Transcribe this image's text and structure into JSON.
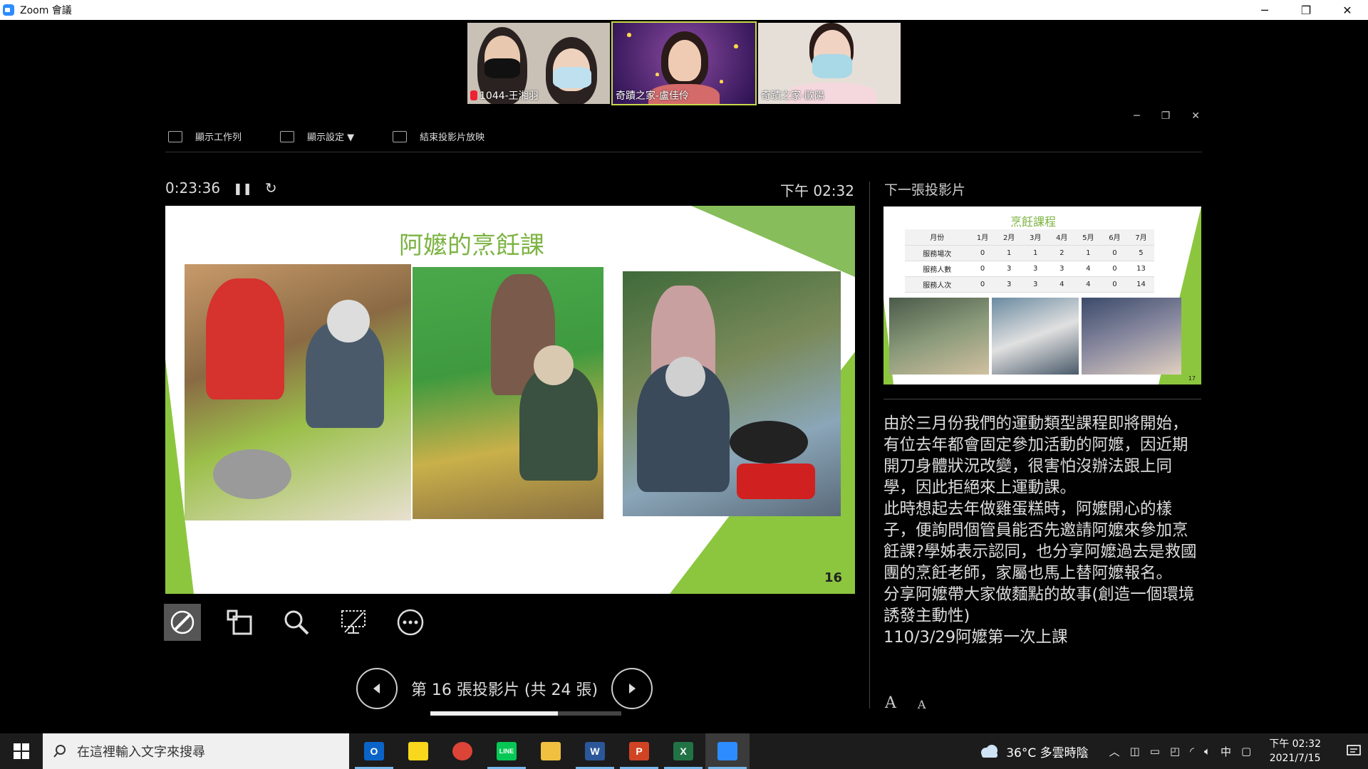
{
  "window": {
    "title": "Zoom 會議",
    "controls": [
      "─",
      "❐",
      "✕"
    ]
  },
  "video": {
    "tiles": [
      {
        "name": "1044-王湘羽",
        "muted": true,
        "bg": "#c9c1b6"
      },
      {
        "name": "奇蹟之家-盧佳伶",
        "muted": false,
        "bg": "#5a2a7a",
        "active": true
      },
      {
        "name": "奇蹟之家-歐陽",
        "muted": false,
        "bg": "#e6dfd8"
      }
    ]
  },
  "presenter": {
    "toolbar": {
      "show_taskbar": "顯示工作列",
      "display_settings": "顯示設定 ▼",
      "end_slideshow": "結束投影片放映"
    },
    "window_controls": [
      "─",
      "❐",
      "✕"
    ],
    "timer": "0:23:36",
    "clock": "下午 02:32",
    "next_label": "下一張投影片"
  },
  "slide": {
    "title": "阿嬤的烹飪課",
    "number": "16",
    "accent": "#8cc63f"
  },
  "next_slide": {
    "title": "烹飪課程",
    "number": "17",
    "table": {
      "headers": [
        "月份",
        "1月",
        "2月",
        "3月",
        "4月",
        "5月",
        "6月",
        "7月"
      ],
      "rows": [
        [
          "服務場次",
          "0",
          "1",
          "1",
          "2",
          "1",
          "0",
          "5"
        ],
        [
          "服務人數",
          "0",
          "3",
          "3",
          "3",
          "4",
          "0",
          "13"
        ],
        [
          "服務人次",
          "0",
          "3",
          "3",
          "4",
          "4",
          "0",
          "14"
        ]
      ]
    }
  },
  "notes": {
    "lines": [
      "由於三月份我們的運動類型課程即將開始，有位去年都會固定參加活動的阿嬤，因近期開刀身體狀況改變，很害怕沒辦法跟上同學，因此拒絕來上運動課。",
      "此時想起去年做雞蛋糕時，阿嬤開心的樣子，便詢問個管員能否先邀請阿嬤來參加烹飪課?學姊表示認同，也分享阿嬤過去是救國團的烹飪老師，家屬也馬上替阿嬤報名。",
      "分享阿嬤帶大家做麵點的故事(創造一個環境 誘發主動性)",
      "110/3/29阿嬤第一次上課"
    ],
    "font_increase": "A",
    "font_decrease": "A"
  },
  "navigation": {
    "label": "第 16 張投影片 (共 24 張)",
    "progress": 0.6667
  },
  "taskbar": {
    "search_placeholder": "在這裡輸入文字來搜尋",
    "apps": [
      {
        "name": "outlook",
        "letter": "O",
        "color": "#0a64c8",
        "running": true
      },
      {
        "name": "sticky-notes",
        "letter": "",
        "color": "#f9d71c",
        "running": false
      },
      {
        "name": "chrome",
        "letter": "",
        "color": "#db4437",
        "running": false
      },
      {
        "name": "line",
        "letter": "LINE",
        "color": "#06c755",
        "running": true
      },
      {
        "name": "file-explorer",
        "letter": "",
        "color": "#f0c040",
        "running": false
      },
      {
        "name": "word",
        "letter": "W",
        "color": "#2b579a",
        "running": true
      },
      {
        "name": "powerpoint",
        "letter": "P",
        "color": "#d04423",
        "running": true
      },
      {
        "name": "excel",
        "letter": "X",
        "color": "#217346",
        "running": true
      },
      {
        "name": "zoom",
        "letter": "",
        "color": "#2d8cff",
        "running": true,
        "active": true
      }
    ],
    "weather": "36°C 多雲時陰",
    "ime": "中",
    "time": "下午 02:32",
    "date": "2021/7/15"
  }
}
